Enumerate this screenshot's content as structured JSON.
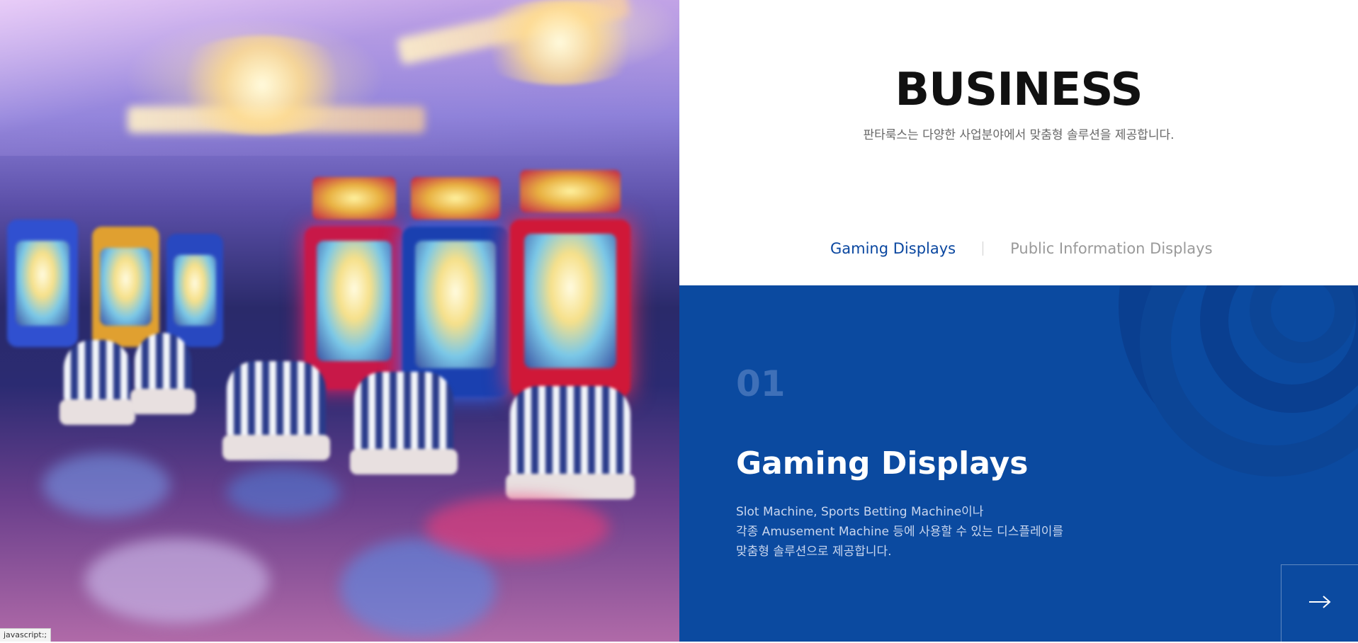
{
  "page": {
    "heading": "BUSINESS",
    "subtitle": "판타룩스는 다양한 사업분야에서 맞춤형 솔루션을 제공합니다."
  },
  "tabs": [
    {
      "label": "Gaming Displays",
      "active": true
    },
    {
      "label": "Public Information Displays",
      "active": false
    }
  ],
  "feature": {
    "number": "01",
    "title": "Gaming Displays",
    "description": [
      "Slot Machine, Sports Betting Machine이나",
      "각종 Amusement Machine 등에 사용할 수 있는 디스플레이를",
      "맞춤형 솔루션으로 제공합니다."
    ],
    "next_icon": "arrow-right-icon"
  },
  "hero_image": {
    "subject": "casino-slot-machines-photo"
  },
  "status_bar": {
    "text": "javascript:;"
  },
  "colors": {
    "accent": "#0b4aa0",
    "active_tab": "#0a47a0",
    "inactive_tab": "#9a9a9a",
    "number": "#3f70b8"
  }
}
